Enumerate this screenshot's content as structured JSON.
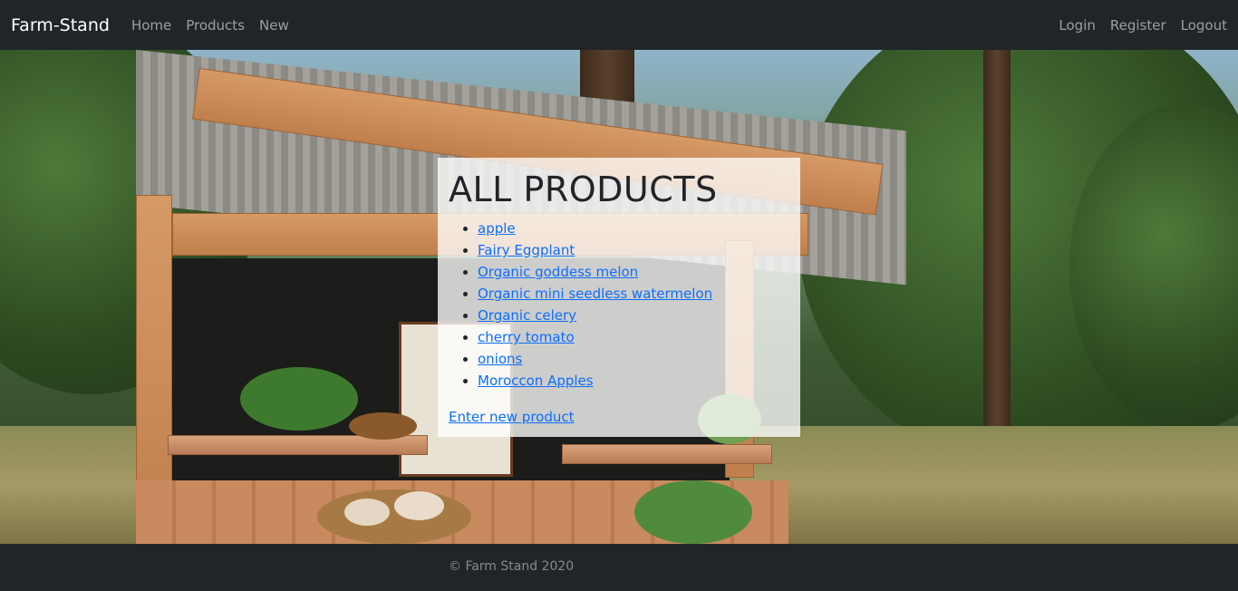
{
  "navbar": {
    "brand": "Farm-Stand",
    "left_links": [
      "Home",
      "Products",
      "New"
    ],
    "right_links": [
      "Login",
      "Register",
      "Logout"
    ]
  },
  "main": {
    "heading": "ALL PRODUCTS",
    "products": [
      "apple",
      "Fairy Eggplant",
      "Organic goddess melon",
      "Organic mini seedless watermelon",
      "Organic celery",
      "cherry tomato",
      "onions",
      "Moroccon Apples"
    ],
    "new_product_link": "Enter new product"
  },
  "footer": {
    "text": "© Farm Stand 2020"
  },
  "colors": {
    "navbar_bg": "#212529",
    "link": "#0d6efd"
  }
}
